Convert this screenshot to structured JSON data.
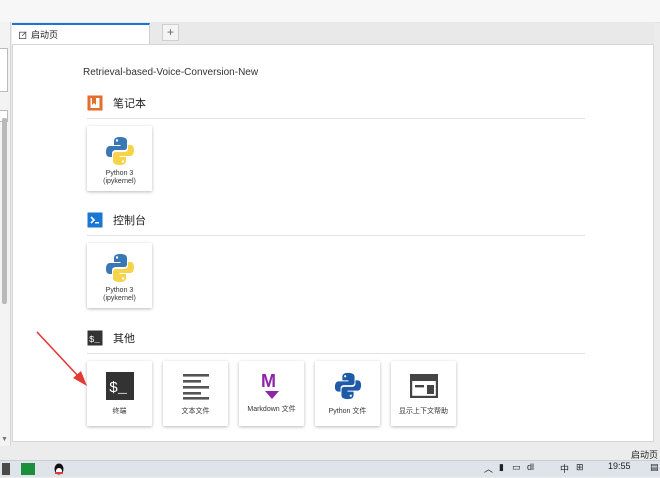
{
  "tab": {
    "label": "启动页",
    "new_tab_label": "+"
  },
  "path": "Retrieval-based-Voice-Conversion-New",
  "sections": {
    "notebook": {
      "title": "笔记本",
      "kernel_line1": "Python 3",
      "kernel_line2": "(ipykernel)"
    },
    "console": {
      "title": "控制台",
      "kernel_line1": "Python 3",
      "kernel_line2": "(ipykernel)"
    },
    "other": {
      "title": "其他",
      "items": [
        "终端",
        "文本文件",
        "Markdown 文件",
        "Python 文件",
        "显示上下文帮助"
      ]
    }
  },
  "status_bar": {
    "label": "启动页"
  },
  "taskbar": {
    "time": "19:55",
    "ime": "中",
    "tray_text": "dl"
  },
  "colors": {
    "accent": "#1976d2",
    "notebook_icon": "#e46e2e",
    "console_icon": "#1976d2",
    "terminal_icon": "#333333",
    "markdown_icon": "#8e24aa",
    "arrow": "#e53935"
  }
}
